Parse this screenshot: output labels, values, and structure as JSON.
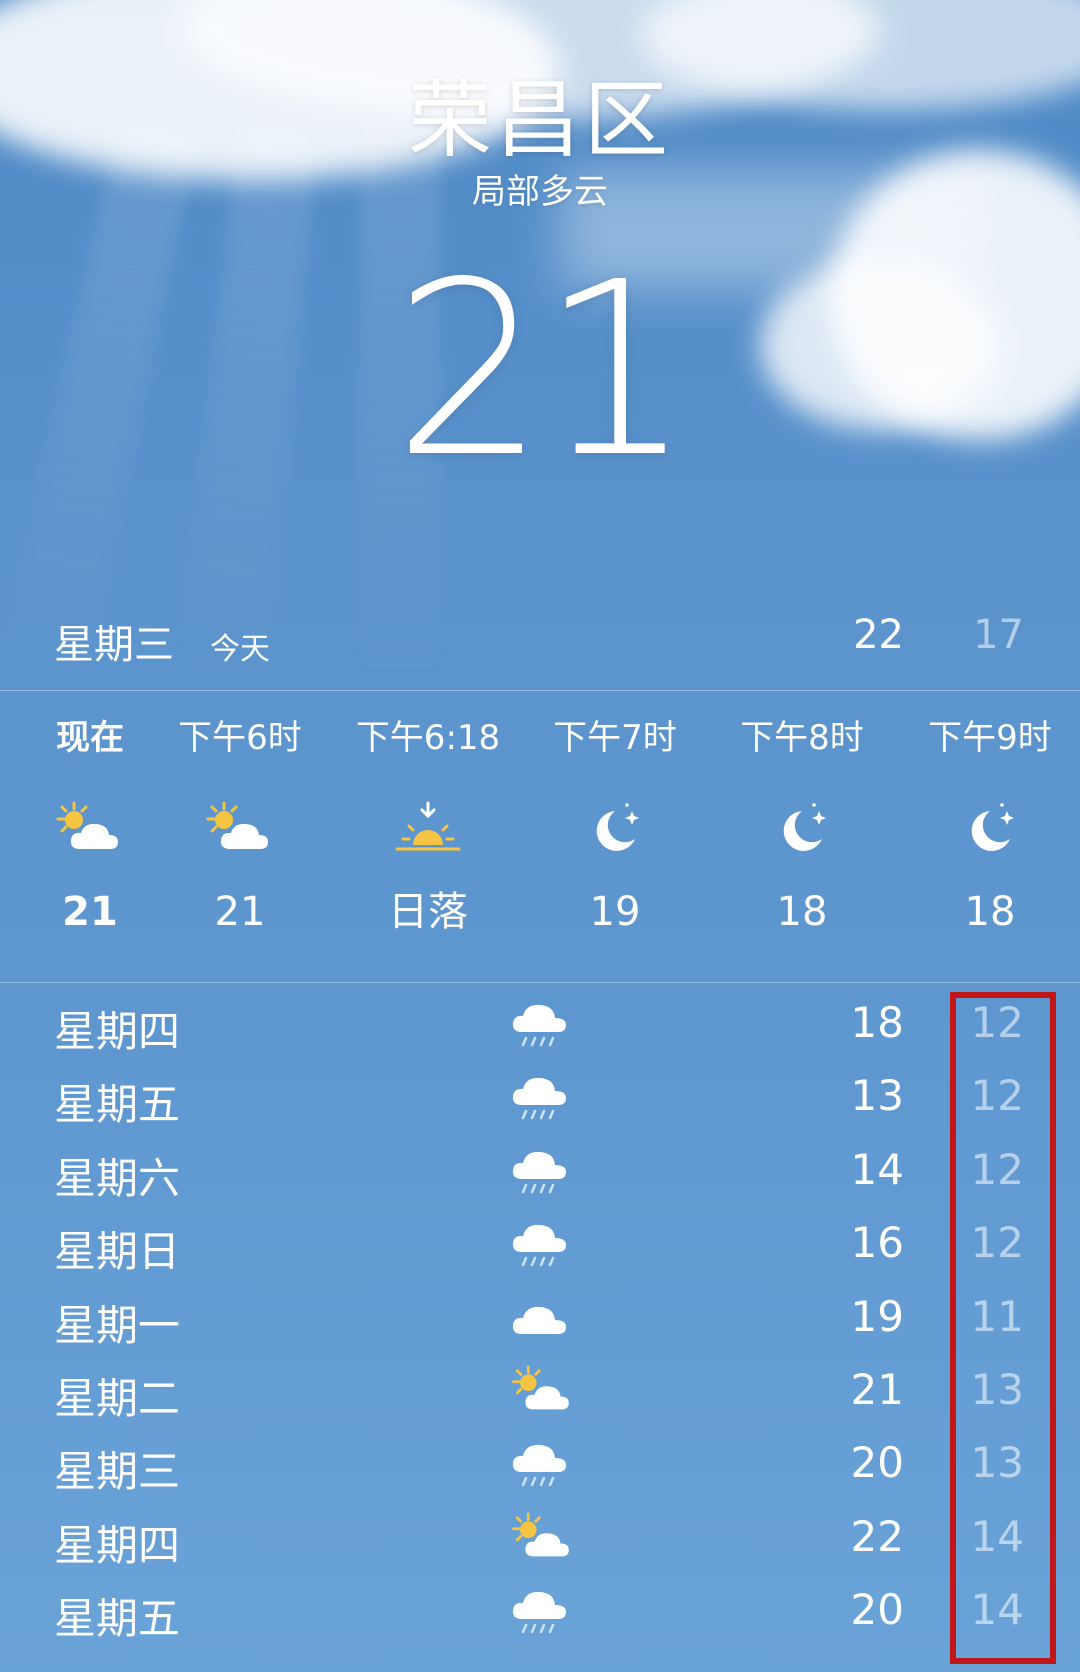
{
  "location": {
    "city": "荣昌区",
    "condition": "局部多云",
    "current_temp": "21"
  },
  "today": {
    "day": "星期三",
    "label": "今天",
    "high": "22",
    "low": "17"
  },
  "hourly": [
    {
      "time": "现在",
      "icon": "partly-sunny-icon",
      "temp": "21"
    },
    {
      "time": "下午6时",
      "icon": "partly-sunny-icon",
      "temp": "21"
    },
    {
      "time": "下午6:18",
      "icon": "sunset-icon",
      "temp": "日落"
    },
    {
      "time": "下午7时",
      "icon": "moon-icon",
      "temp": "19"
    },
    {
      "time": "下午8时",
      "icon": "moon-icon",
      "temp": "18"
    },
    {
      "time": "下午9时",
      "icon": "moon-icon",
      "temp": "18"
    }
  ],
  "daily": [
    {
      "day": "星期四",
      "icon": "rain-cloud-icon",
      "high": "18",
      "low": "12"
    },
    {
      "day": "星期五",
      "icon": "rain-cloud-icon",
      "high": "13",
      "low": "12"
    },
    {
      "day": "星期六",
      "icon": "rain-cloud-icon",
      "high": "14",
      "low": "12"
    },
    {
      "day": "星期日",
      "icon": "rain-cloud-icon",
      "high": "16",
      "low": "12"
    },
    {
      "day": "星期一",
      "icon": "cloud-icon",
      "high": "19",
      "low": "11"
    },
    {
      "day": "星期二",
      "icon": "partly-sunny-icon",
      "high": "21",
      "low": "13"
    },
    {
      "day": "星期三",
      "icon": "rain-cloud-icon",
      "high": "20",
      "low": "13"
    },
    {
      "day": "星期四",
      "icon": "partly-sunny-icon",
      "high": "22",
      "low": "14"
    },
    {
      "day": "星期五",
      "icon": "rain-cloud-icon",
      "high": "20",
      "low": "14"
    }
  ],
  "colors": {
    "sky": "#5b93cd",
    "highlight_box": "#c01818",
    "sun": "#f5c542"
  }
}
